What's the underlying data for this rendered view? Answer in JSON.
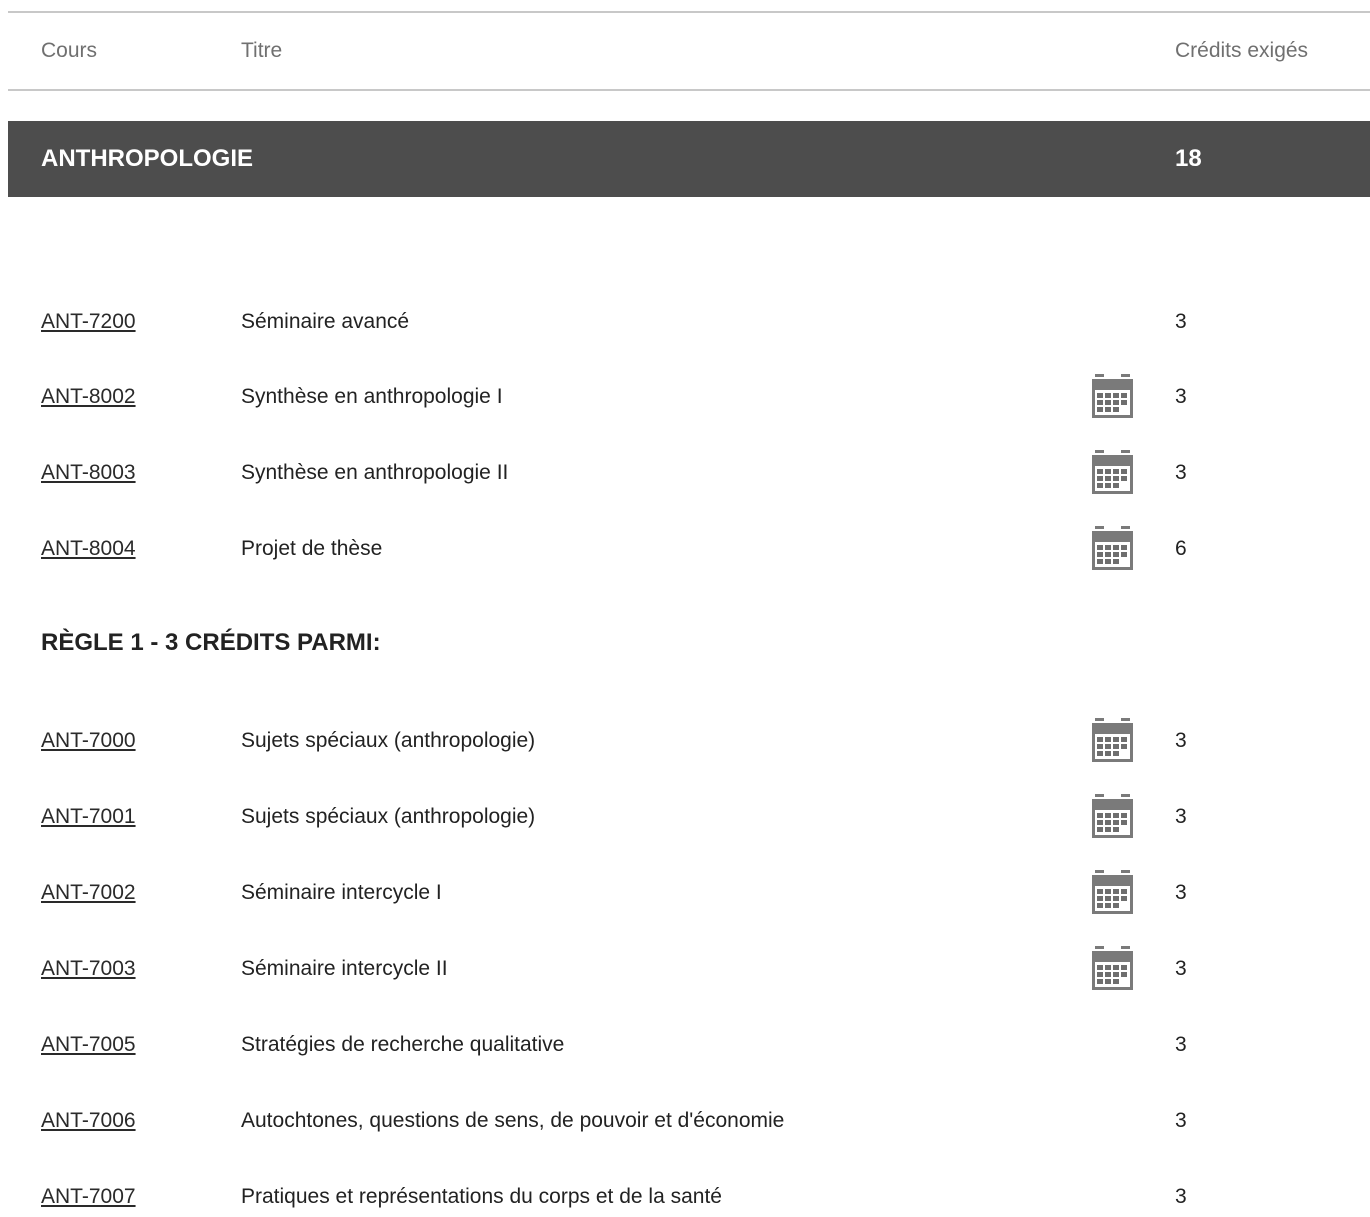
{
  "header": {
    "cours": "Cours",
    "titre": "Titre",
    "credits": "Crédits exigés"
  },
  "section": {
    "title": "ANTHROPOLOGIE",
    "credits": "18"
  },
  "required_courses": [
    {
      "code": "ANT-7200",
      "title": "Séminaire avancé",
      "calendar": false,
      "credits": "3"
    },
    {
      "code": "ANT-8002",
      "title": "Synthèse en anthropologie I",
      "calendar": true,
      "credits": "3"
    },
    {
      "code": "ANT-8003",
      "title": "Synthèse en anthropologie II",
      "calendar": true,
      "credits": "3"
    },
    {
      "code": "ANT-8004",
      "title": "Projet de thèse",
      "calendar": true,
      "credits": "6"
    }
  ],
  "rule1": {
    "heading": "RÈGLE 1 - 3 CRÉDITS PARMI:",
    "courses": [
      {
        "code": "ANT-7000",
        "title": "Sujets spéciaux (anthropologie)",
        "calendar": true,
        "credits": "3"
      },
      {
        "code": "ANT-7001",
        "title": "Sujets spéciaux (anthropologie)",
        "calendar": true,
        "credits": "3"
      },
      {
        "code": "ANT-7002",
        "title": "Séminaire intercycle I",
        "calendar": true,
        "credits": "3"
      },
      {
        "code": "ANT-7003",
        "title": "Séminaire intercycle II",
        "calendar": true,
        "credits": "3"
      },
      {
        "code": "ANT-7005",
        "title": "Stratégies de recherche qualitative",
        "calendar": false,
        "credits": "3"
      },
      {
        "code": "ANT-7006",
        "title": "Autochtones, questions de sens, de pouvoir et d'économie",
        "calendar": false,
        "credits": "3"
      },
      {
        "code": "ANT-7007",
        "title": "Pratiques et représentations du corps et de la santé",
        "calendar": false,
        "credits": "3"
      }
    ]
  },
  "icons": {
    "calendar": "calendar-icon"
  },
  "colors": {
    "section_bar": "#4d4d4d",
    "calendar_icon": "#7a7a7a"
  }
}
